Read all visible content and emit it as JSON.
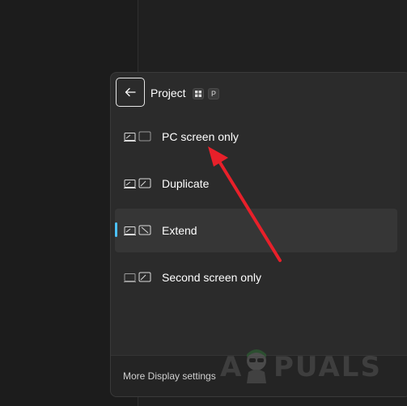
{
  "flyout": {
    "title": "Project",
    "shortcut_keys": [
      "⊞",
      "P"
    ],
    "options": [
      {
        "label": "PC screen only",
        "icon": "pc-screen-only-icon",
        "selected": false
      },
      {
        "label": "Duplicate",
        "icon": "duplicate-icon",
        "selected": false
      },
      {
        "label": "Extend",
        "icon": "extend-icon",
        "selected": true
      },
      {
        "label": "Second screen only",
        "icon": "second-screen-only-icon",
        "selected": false
      }
    ],
    "footer_link": "More Display settings"
  },
  "watermark": {
    "text_a": "A",
    "text_b": "PUALS"
  },
  "colors": {
    "accent": "#4cc2ff",
    "annotation_arrow": "#e8202a",
    "flyout_bg": "#2b2b2b",
    "selected_bg": "#363636"
  }
}
